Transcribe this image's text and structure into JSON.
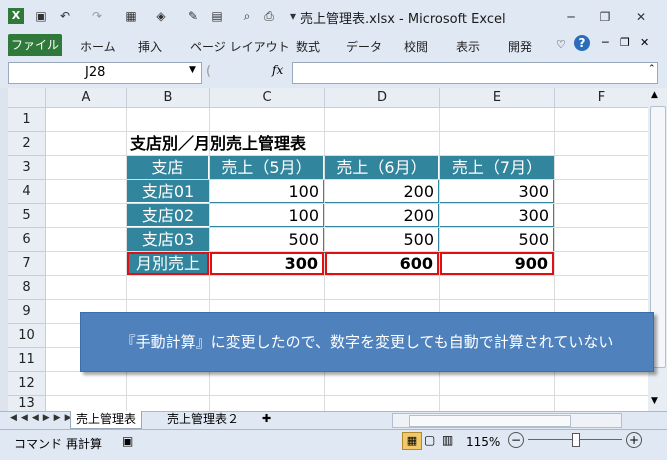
{
  "window": {
    "title": "売上管理表.xlsx - Microsoft Excel"
  },
  "ribbon": {
    "tabs": [
      "ファイル",
      "ホーム",
      "挿入",
      "ページ レイアウト",
      "数式",
      "データ",
      "校閲",
      "表示",
      "開発"
    ]
  },
  "formula_bar": {
    "name_box": "J28",
    "fx": "fx",
    "formula": ""
  },
  "columns": [
    "A",
    "B",
    "C",
    "D",
    "E",
    "F"
  ],
  "rows": [
    "1",
    "2",
    "3",
    "4",
    "5",
    "6",
    "7",
    "8",
    "9",
    "10",
    "11",
    "12",
    "13"
  ],
  "sheet": {
    "table_title": "支店別／月別売上管理表",
    "headers": [
      "支店",
      "売上（5月）",
      "売上（6月）",
      "売上（7月）"
    ],
    "data_rows": [
      {
        "label": "支店01",
        "values": [
          "100",
          "200",
          "300"
        ]
      },
      {
        "label": "支店02",
        "values": [
          "100",
          "200",
          "300"
        ]
      },
      {
        "label": "支店03",
        "values": [
          "500",
          "500",
          "500"
        ]
      }
    ],
    "total_row": {
      "label": "月別売上",
      "values": [
        "300",
        "600",
        "900"
      ]
    }
  },
  "callout": {
    "text": "『手動計算』に変更したので、数字を変更しても自動で計算されていない"
  },
  "sheet_tabs": [
    "売上管理表",
    "売上管理表２"
  ],
  "status": {
    "mode": "コマンド",
    "recalc": "再計算",
    "zoom": "115%"
  }
}
